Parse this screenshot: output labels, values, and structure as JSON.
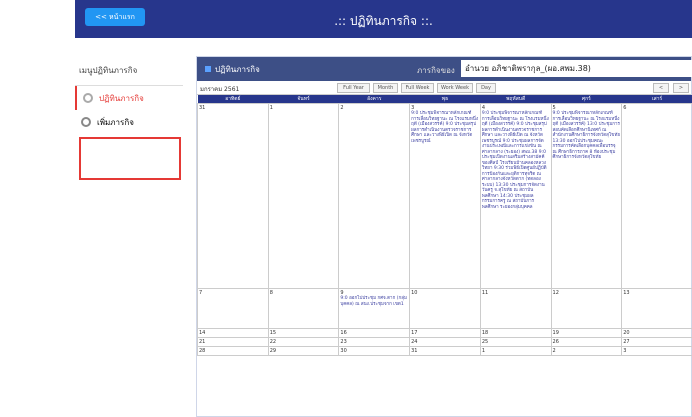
{
  "header": {
    "home_label": "<< หน้าแรก",
    "title": ".:: ปฏิทินภารกิจ ::."
  },
  "sidebar": {
    "title": "เมนูปฏิทินภารกิจ",
    "items": [
      {
        "label": "ปฏิทินภารกิจ"
      },
      {
        "label": "เพิ่มภารกิจ"
      }
    ]
  },
  "panel": {
    "title": "ปฏิทินภารกิจ",
    "owner_label": "ภารกิจของ",
    "owner_value": "อำนวย อภิชาติพรากุล_(ผอ.สพม.38)"
  },
  "toolbar": {
    "month": "มกราคม 2561",
    "buttons": [
      "Full Year",
      "Month",
      "Full Week",
      "Work Week",
      "Day"
    ],
    "prev": "<",
    "next": ">"
  },
  "calendar": {
    "days": [
      "อาทิตย์",
      "จันทร์",
      "อังคาร",
      "พุธ",
      "พฤหัสบดี",
      "ศุกร์",
      "เสาร์"
    ],
    "weeks": [
      [
        "31",
        "1",
        "2",
        "3",
        "4",
        "5",
        "6"
      ],
      [
        "7",
        "8",
        "9",
        "10",
        "11",
        "12",
        "13"
      ],
      [
        "14",
        "15",
        "16",
        "17",
        "18",
        "19",
        "20"
      ],
      [
        "21",
        "22",
        "23",
        "24",
        "25",
        "26",
        "27"
      ],
      [
        "28",
        "29",
        "30",
        "31",
        "1",
        "2",
        "3"
      ]
    ],
    "events": {
      "w0_wed": "9:0 ประชุมพิจารณาหลักเกณฑ์การเลื่อนวิทยฐานะ ณ โรงแรมหนึ่งฤดี (เมืองสวรรค์) 9:0 ประชุมสรุปผลการดำเนินงานตรวจราชการศึกษา และวางพิธีเปิด ณ จังหวัดเพชรบูรณ์",
      "w0_thu": "9:0 ประชุมพิจารณาหลักเกณฑ์การเลื่อนวิทยฐานะ ณ โรงแรมหนึ่งฤดี (เมืองสวรรค์) 9:0 ประชุมสรุปผลการดำเนินงานตรวจราชการศึกษา และวางพิธีเปิด ณ จังหวัดเพชรบูรณ์ 9:0 ประชุมผลการจัดงานประเพณีและการแข่งขัน ณ ศาลากลาง (ระยอง) สพม.38 9:0 ประชุมเปิดงานเสริมสร้างสามัคคีของศิลป์ โรงเรียนบ้านคลองหลวงวิทยา 9:30 ร่วมพิธีเปิดศูนย์ปฏิบัติการป้องกันและยุติการทุจริต ณ ศาลากลางจังหวัดตาก (ทดลองระบบ) 13:30 ประชุมการจัดงานวันครู จ.สุโขทัย ณ สถาบันพลศึกษา 14:30 ประชุมผลกรรมการครู ณ สถาบันการพลศึกษา ระยองกลุ่มบุคคล",
      "w0_fri": "9:0 ประชุมพิจารณาหลักเกณฑ์การเลื่อนวิทยฐานะ ณ โรงแรมหนึ่งฤดี (เมืองสวรรค์) 13:0 ประชุมการสอบคัดเลือกศึกษานิเทศก์ ณ สำนักงานศึกษาธิการจังหวัดสุโขทัย 13:30 ออกไปประชุมคณะกรรมการคัดเลือกบุคคลเพื่อบรรจุ ณ ศึกษาธิการภาค 8 ห้องประชุมศึกษาธิการจังหวัดสุโขทัย",
      "w1_tue": "9:0 ออกไปประชุม กศจ.ตาก (กลุ่มบุคคล) ณ สนง.ประชุมจาก เขต1"
    }
  },
  "colors": {
    "header_bg": "#27368c",
    "home_btn": "#2196f3",
    "panel_head": "#3d4f86",
    "accent": "#e53935"
  }
}
